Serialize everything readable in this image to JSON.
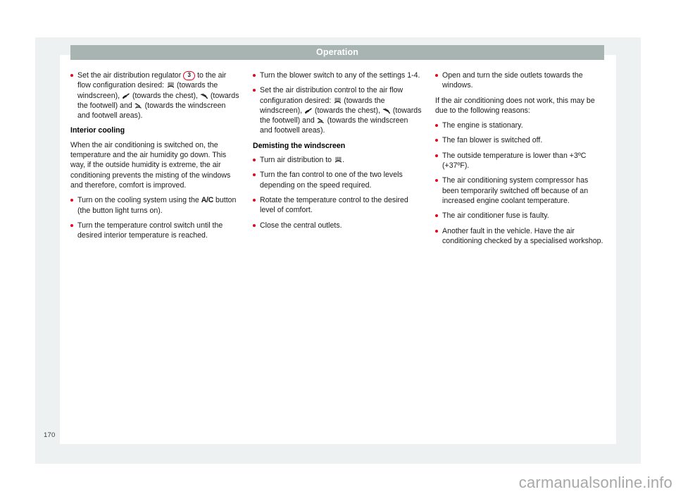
{
  "document": {
    "header_title": "Operation",
    "page_number": "170",
    "watermark": "carmanualsonline.info"
  },
  "columns": [
    {
      "id": "left",
      "blocks": [
        {
          "type": "bullet",
          "segments": [
            {
              "text": "Set the air distribution regulator "
            },
            {
              "ref": "3"
            },
            {
              "text": " to the air flow configuration desired: "
            },
            {
              "icon": "defrost-windscreen-icon"
            },
            {
              "text": " (towards the windscreen), "
            },
            {
              "icon": "chest-vent-icon"
            },
            {
              "text": " (towards the chest), "
            },
            {
              "icon": "footwell-vent-icon"
            },
            {
              "text": " (towards the footwell) and "
            },
            {
              "icon": "windscreen-footwell-icon"
            },
            {
              "text": " (towards the windscreen and footwell areas)."
            }
          ]
        },
        {
          "type": "subhead",
          "text": "Interior cooling"
        },
        {
          "type": "para",
          "text": "When the air conditioning is switched on, the temperature and the air humidity go down. This way, if the outside humidity is extreme, the air conditioning prevents the misting of the windows and therefore, comfort is improved."
        },
        {
          "type": "bullet",
          "segments": [
            {
              "text": "Turn on the cooling system using the "
            },
            {
              "bold": "A/C"
            },
            {
              "text": " button (the button light turns on)."
            }
          ]
        },
        {
          "type": "bullet",
          "segments": [
            {
              "text": "Turn the temperature control switch until the desired interior temperature is reached."
            }
          ]
        }
      ]
    },
    {
      "id": "middle",
      "blocks": [
        {
          "type": "bullet",
          "segments": [
            {
              "text": "Turn the blower switch to any of the settings 1-4."
            }
          ]
        },
        {
          "type": "bullet",
          "segments": [
            {
              "text": "Set the air distribution control to the air flow configuration desired: "
            },
            {
              "icon": "defrost-windscreen-icon"
            },
            {
              "text": " (towards the windscreen), "
            },
            {
              "icon": "chest-vent-icon"
            },
            {
              "text": " (towards the chest), "
            },
            {
              "icon": "footwell-vent-icon"
            },
            {
              "text": " (towards the footwell) and "
            },
            {
              "icon": "windscreen-footwell-icon"
            },
            {
              "text": " (towards the windscreen and footwell areas)."
            }
          ]
        },
        {
          "type": "subhead",
          "text": "Demisting the windscreen"
        },
        {
          "type": "bullet",
          "segments": [
            {
              "text": "Turn air distribution to "
            },
            {
              "icon": "defrost-windscreen-icon"
            },
            {
              "text": "."
            }
          ]
        },
        {
          "type": "bullet",
          "segments": [
            {
              "text": "Turn the fan control to one of the two levels depending on the speed required."
            }
          ]
        },
        {
          "type": "bullet",
          "segments": [
            {
              "text": "Rotate the temperature control to the desired level of comfort."
            }
          ]
        },
        {
          "type": "bullet",
          "segments": [
            {
              "text": "Close the central outlets."
            }
          ]
        }
      ]
    },
    {
      "id": "right",
      "blocks": [
        {
          "type": "bullet",
          "segments": [
            {
              "text": "Open and turn the side outlets towards the windows."
            }
          ]
        },
        {
          "type": "para",
          "text": "If the air conditioning does not work, this may be due to the following reasons:"
        },
        {
          "type": "bullet",
          "segments": [
            {
              "text": "The engine is stationary."
            }
          ]
        },
        {
          "type": "bullet",
          "segments": [
            {
              "text": "The fan blower is switched off."
            }
          ]
        },
        {
          "type": "bullet",
          "segments": [
            {
              "text": "The outside temperature is lower than +3ºC (+37ºF)."
            }
          ]
        },
        {
          "type": "bullet",
          "segments": [
            {
              "text": "The air conditioning system compressor has been temporarily switched off because of an increased engine coolant temperature."
            }
          ]
        },
        {
          "type": "bullet",
          "segments": [
            {
              "text": "The air conditioner fuse is faulty."
            }
          ]
        },
        {
          "type": "bullet",
          "segments": [
            {
              "text": "Another fault in the vehicle. Have the air conditioning checked by a specialised workshop."
            }
          ]
        }
      ]
    }
  ],
  "colors": {
    "header_bar": "#a7b4b2",
    "bullet_red": "#e3051b",
    "page_surround": "#edf1f2",
    "text": "#1b1b1b",
    "watermark": "#a8a8a8"
  }
}
